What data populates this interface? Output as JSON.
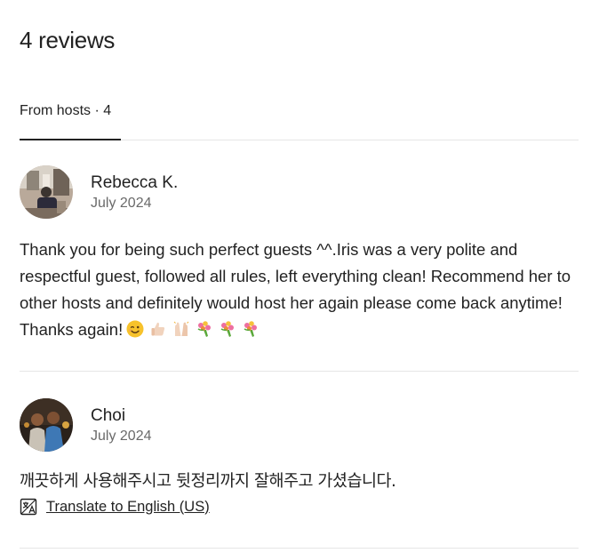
{
  "header": {
    "title": "4 reviews"
  },
  "tabs": [
    {
      "label": "From hosts · 4",
      "active": true
    }
  ],
  "reviews": [
    {
      "name": "Rebecca K.",
      "date": "July 2024",
      "text": "Thank you for being such perfect guests ^^.Iris was a very polite and respectful guest, followed all rules, left everything clean! Recommend her to other hosts and definitely would host her again please come back anytime! Thanks again!",
      "emojis": [
        "wink-face-emoji",
        "thumbs-up-emoji",
        "raised-hands-emoji",
        "bouquet-emoji",
        "bouquet-emoji",
        "bouquet-emoji"
      ]
    },
    {
      "name": "Choi",
      "date": "July 2024",
      "text": "깨끗하게 사용해주시고 뒷정리까지 잘해주고 가셨습니다.",
      "translate_label": "Translate to English (US)"
    }
  ],
  "colors": {
    "text": "#222222",
    "muted": "#6a6a6a",
    "divider": "#e6e6e6"
  }
}
